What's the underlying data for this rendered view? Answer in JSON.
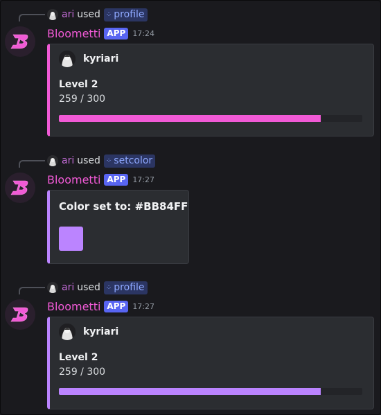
{
  "colors": {
    "pink": "#f15ad6",
    "purple": "#bb84ff",
    "app_badge": "#5865f2",
    "background": "#1a1a1e"
  },
  "messages": [
    {
      "reply": {
        "user": "ari",
        "used": "used",
        "command": "profile"
      },
      "bot_name": "Bloometti",
      "app_badge": "APP",
      "time": "17:24",
      "embed": {
        "type": "profile",
        "author": "kyriari",
        "level": "Level 2",
        "xp": "259 / 300",
        "progress": 0.863,
        "accent": "#f15ad6"
      }
    },
    {
      "reply": {
        "user": "ari",
        "used": "used",
        "command": "setcolor"
      },
      "bot_name": "Bloometti",
      "app_badge": "APP",
      "time": "17:27",
      "embed": {
        "type": "color",
        "title": "Color set to: #BB84FF",
        "swatch": "#bb84ff",
        "accent": "#bb84ff"
      }
    },
    {
      "reply": {
        "user": "ari",
        "used": "used",
        "command": "profile"
      },
      "bot_name": "Bloometti",
      "app_badge": "APP",
      "time": "17:27",
      "embed": {
        "type": "profile",
        "author": "kyriari",
        "level": "Level 2",
        "xp": "259 / 300",
        "progress": 0.863,
        "accent": "#bb84ff"
      }
    }
  ]
}
